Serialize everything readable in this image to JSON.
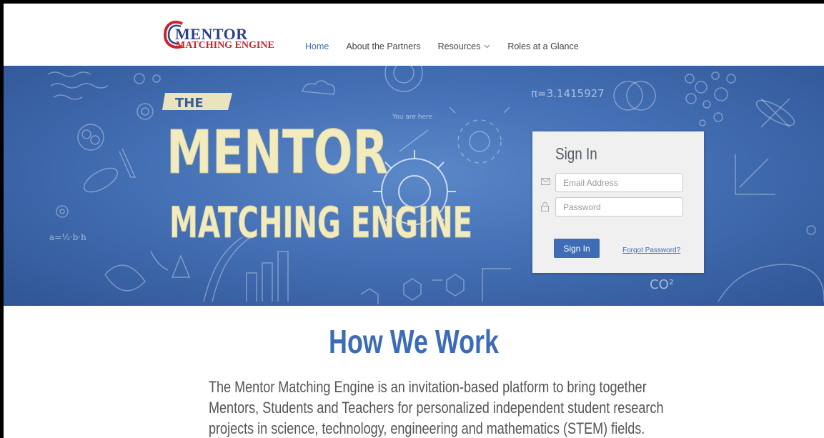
{
  "header": {
    "logo": {
      "line1": "MENTOR",
      "line2": "MATCHING ENGINE"
    },
    "nav": [
      {
        "label": "Home",
        "active": true
      },
      {
        "label": "About the Partners",
        "active": false
      },
      {
        "label": "Resources",
        "active": false,
        "has_dropdown": true
      },
      {
        "label": "Roles at a Glance",
        "active": false
      }
    ]
  },
  "hero": {
    "banner_the": "THE",
    "banner_title_1": "MENTOR",
    "banner_title_2": "MATCHING ENGINE",
    "chalk_pi": "π=3.1415927",
    "chalk_you_are_here": "You are here",
    "chalk_formula": "a=½·b·h",
    "chalk_co2": "CO²"
  },
  "signin": {
    "title": "Sign In",
    "email_placeholder": "Email Address",
    "password_placeholder": "Password",
    "button_label": "Sign In",
    "forgot_label": "Forgot Password?",
    "email_icon": "envelope-icon",
    "password_icon": "lock-icon"
  },
  "content": {
    "title": "How We Work",
    "paragraph_lines": [
      "The Mentor Matching Engine is an invitation-based platform to bring together",
      "Mentors, Students and Teachers for personalized independent student research",
      "projects in science, technology, engineering and mathematics (STEM) fields."
    ]
  },
  "colors": {
    "accent": "#3d6cb7",
    "logo_blue": "#2b3f8c",
    "logo_red": "#c7262c",
    "hero_blue": "#4470b5",
    "chalk": "#f2ebbe"
  }
}
